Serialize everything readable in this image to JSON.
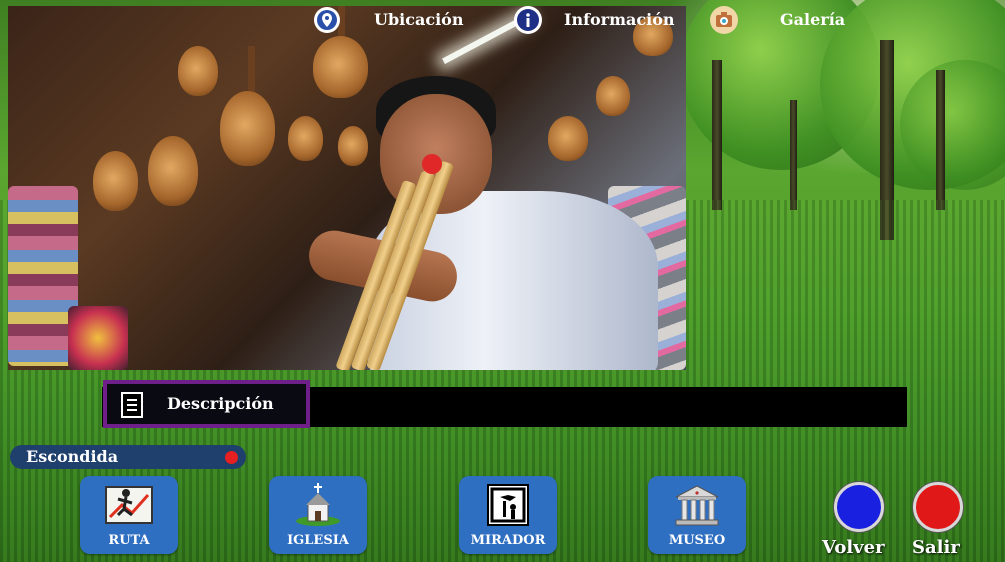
{
  "tabs": [
    {
      "label": "Descripción",
      "icon": "document-icon",
      "active": true
    },
    {
      "label": "Ubicación",
      "icon": "location-pin-icon",
      "active": false
    },
    {
      "label": "Información",
      "icon": "info-icon",
      "active": false
    },
    {
      "label": "Galería",
      "icon": "camera-icon",
      "active": false
    }
  ],
  "place": {
    "name": "Escondida",
    "status_color": "#e62020"
  },
  "nav": [
    {
      "label": "RUTA",
      "icon": "route-map-icon"
    },
    {
      "label": "IGLESIA",
      "icon": "church-icon"
    },
    {
      "label": "MIRADOR",
      "icon": "viewpoint-icon"
    },
    {
      "label": "MUSEO",
      "icon": "museum-icon"
    }
  ],
  "actions": {
    "back": {
      "label": "Volver",
      "color": "#1a20e0"
    },
    "exit": {
      "label": "Salir",
      "color": "#e01818"
    }
  },
  "colors": {
    "tab_active_border": "#6f1f8a",
    "nav_button": "#2f6fc2",
    "badge": "#1f3f6c"
  }
}
